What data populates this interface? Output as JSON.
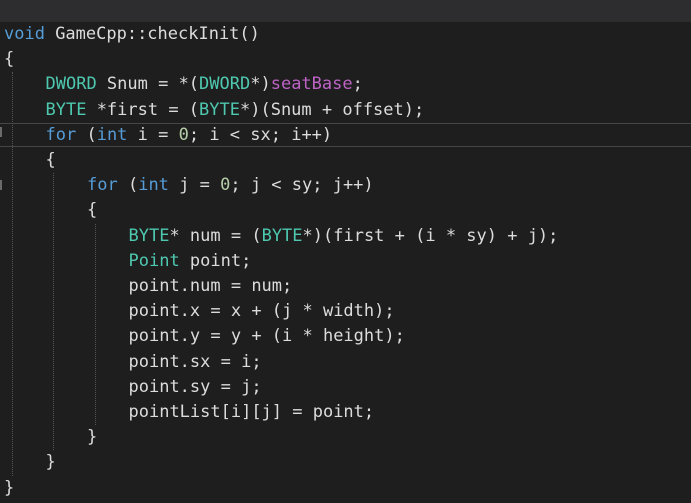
{
  "editor": {
    "theme_colors": {
      "background": "#1e1e1e",
      "keyword": "#569cd6",
      "type": "#4ec9b0",
      "macro": "#bd63c5",
      "number": "#b5cea8",
      "plain": "#dcdcdc"
    },
    "lines": [
      {
        "indent": 0,
        "tokens": [
          {
            "t": "kw",
            "v": "void"
          },
          {
            "t": "pl",
            "v": " GameCpp::checkInit()"
          }
        ]
      },
      {
        "indent": 0,
        "tokens": [
          {
            "t": "pl",
            "v": "{"
          }
        ]
      },
      {
        "indent": 1,
        "tokens": [
          {
            "t": "ty",
            "v": "DWORD"
          },
          {
            "t": "pl",
            "v": " Snum = *("
          },
          {
            "t": "ty",
            "v": "DWORD"
          },
          {
            "t": "pl",
            "v": "*)"
          },
          {
            "t": "mac",
            "v": "seatBase"
          },
          {
            "t": "pl",
            "v": ";"
          }
        ]
      },
      {
        "indent": 1,
        "tokens": [
          {
            "t": "ty",
            "v": "BYTE"
          },
          {
            "t": "pl",
            "v": " *first = ("
          },
          {
            "t": "ty",
            "v": "BYTE"
          },
          {
            "t": "pl",
            "v": "*)(Snum + offset);"
          }
        ]
      },
      {
        "indent": 1,
        "tokens": [
          {
            "t": "kw",
            "v": "for"
          },
          {
            "t": "pl",
            "v": " ("
          },
          {
            "t": "kw",
            "v": "int"
          },
          {
            "t": "pl",
            "v": " i = "
          },
          {
            "t": "num",
            "v": "0"
          },
          {
            "t": "pl",
            "v": "; i < sx; i++)"
          }
        ]
      },
      {
        "indent": 1,
        "tokens": [
          {
            "t": "pl",
            "v": "{"
          }
        ]
      },
      {
        "indent": 2,
        "tokens": [
          {
            "t": "kw",
            "v": "for"
          },
          {
            "t": "pl",
            "v": " ("
          },
          {
            "t": "kw",
            "v": "int"
          },
          {
            "t": "pl",
            "v": " j = "
          },
          {
            "t": "num",
            "v": "0"
          },
          {
            "t": "pl",
            "v": "; j < sy; j++)"
          }
        ]
      },
      {
        "indent": 2,
        "tokens": [
          {
            "t": "pl",
            "v": "{"
          }
        ]
      },
      {
        "indent": 3,
        "tokens": [
          {
            "t": "ty",
            "v": "BYTE"
          },
          {
            "t": "pl",
            "v": "* num = ("
          },
          {
            "t": "ty",
            "v": "BYTE"
          },
          {
            "t": "pl",
            "v": "*)(first + (i * sy) + j);"
          }
        ]
      },
      {
        "indent": 3,
        "tokens": [
          {
            "t": "ty",
            "v": "Point"
          },
          {
            "t": "pl",
            "v": " point;"
          }
        ]
      },
      {
        "indent": 3,
        "tokens": [
          {
            "t": "pl",
            "v": "point.num = num;"
          }
        ]
      },
      {
        "indent": 3,
        "tokens": [
          {
            "t": "pl",
            "v": "point.x = x + (j * width);"
          }
        ]
      },
      {
        "indent": 3,
        "tokens": [
          {
            "t": "pl",
            "v": "point.y = y + (i * height);"
          }
        ]
      },
      {
        "indent": 3,
        "tokens": [
          {
            "t": "pl",
            "v": "point.sx = i;"
          }
        ]
      },
      {
        "indent": 3,
        "tokens": [
          {
            "t": "pl",
            "v": "point.sy = j;"
          }
        ]
      },
      {
        "indent": 3,
        "tokens": [
          {
            "t": "pl",
            "v": "pointList[i][j] = point;"
          }
        ]
      },
      {
        "indent": 2,
        "tokens": [
          {
            "t": "pl",
            "v": "}"
          }
        ]
      },
      {
        "indent": 1,
        "tokens": [
          {
            "t": "pl",
            "v": "}"
          }
        ]
      },
      {
        "indent": 0,
        "tokens": [
          {
            "t": "pl",
            "v": "}"
          }
        ]
      }
    ],
    "current_line_index": 4
  }
}
